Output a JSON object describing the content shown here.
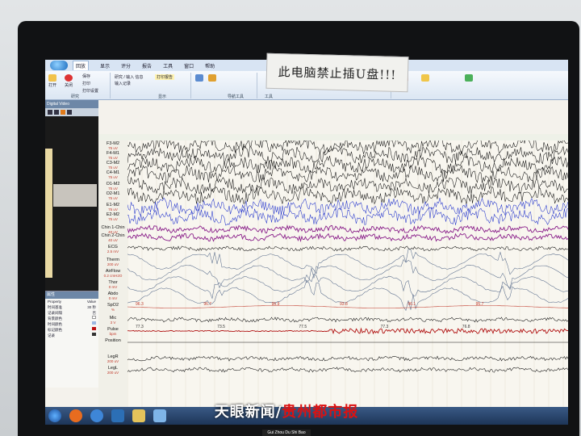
{
  "sticker": {
    "text": "此电脑禁止插U盘!!!"
  },
  "ribbon": {
    "tabs": [
      "回放",
      "显示",
      "评分",
      "报告",
      "工具",
      "窗口",
      "帮助"
    ],
    "active_tab": "回放",
    "buttons": {
      "open": "打开",
      "close": "关闭",
      "save": "保存",
      "print": "打印",
      "print_settings": "打印设置",
      "record_input": "研究 / 输入 信息",
      "input_record": "输入记录",
      "print_report": "打印报告"
    },
    "groups": [
      "研究",
      "显示",
      "导航工具",
      "工具"
    ]
  },
  "video": {
    "title": "Digital Video"
  },
  "properties": {
    "title": "属性",
    "rows": [
      {
        "k": "Property",
        "v": "Value"
      },
      {
        "k": "时间基准",
        "v": "30 秒"
      },
      {
        "k": "记录间隔",
        "v": "否"
      },
      {
        "k": "背景颜色",
        "v": ""
      },
      {
        "k": "时间颜色",
        "v": ""
      },
      {
        "k": "标记颜色",
        "v": ""
      },
      {
        "k": "记录",
        "v": ""
      }
    ]
  },
  "channels": [
    {
      "name": "F3-M2",
      "scale": "75 uV"
    },
    {
      "name": "F4-M1",
      "scale": "75 uV"
    },
    {
      "name": "C3-M2",
      "scale": "75 uV"
    },
    {
      "name": "C4-M1",
      "scale": "75 uV"
    },
    {
      "name": "O1-M2",
      "scale": "75 uV"
    },
    {
      "name": "O2-M1",
      "scale": "75 uV"
    },
    {
      "name": "E1-M2",
      "scale": "75 uV"
    },
    {
      "name": "E2-M2",
      "scale": "75 uV"
    },
    {
      "name": "Chin 1-Chin",
      "scale": "40 uV"
    },
    {
      "name": "Chin 2-Chin",
      "scale": "40 uV"
    },
    {
      "name": "ECG",
      "scale": "2.5 mV"
    },
    {
      "name": "Therm",
      "scale": "200 uV"
    },
    {
      "name": "AirFlow",
      "scale": "0.2 cmH2O"
    },
    {
      "name": "Thor",
      "scale": "0 mV"
    },
    {
      "name": "Abdo",
      "scale": "0 mV"
    },
    {
      "name": "SpO2",
      "scale": "%"
    },
    {
      "name": "Mic",
      "scale": "3 V"
    },
    {
      "name": "Pulse",
      "scale": "bpm"
    },
    {
      "name": "Position",
      "scale": ""
    },
    {
      "name": "LegR",
      "scale": "200 uV"
    },
    {
      "name": "LegL",
      "scale": "200 uV"
    }
  ],
  "annotations": {
    "spo2": [
      "96.3",
      "96.7",
      "95.9",
      "93.8",
      "96.1",
      "95.7"
    ],
    "pulse": [
      "77.3",
      "73.5",
      "77.5",
      "77.3",
      "76.8"
    ]
  },
  "watermark": {
    "main_a": "天眼新闻",
    "main_b": "贵州都市报",
    "sub": "Gui Zhou Du Shi Bao"
  },
  "colors": {
    "eeg": "#111111",
    "eog": "#2233cc",
    "emg": "#8a1f8a",
    "resp": "#5a6d8c",
    "spo2": "#c0392b",
    "pulse_noise": "#b01010"
  }
}
